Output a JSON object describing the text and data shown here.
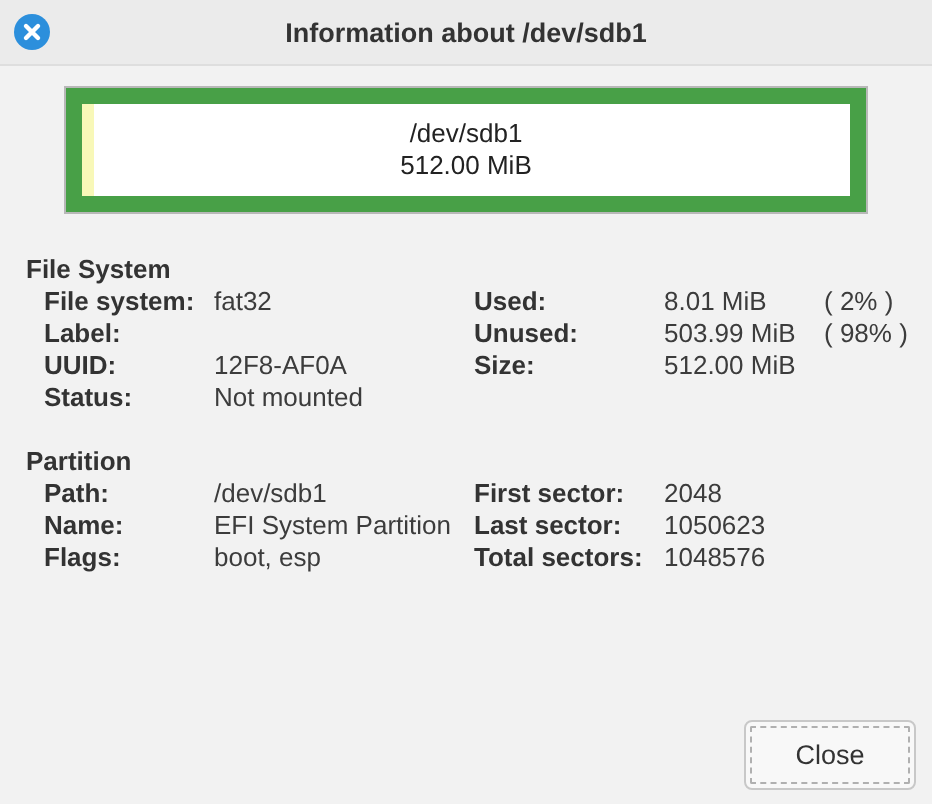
{
  "window": {
    "title": "Information about /dev/sdb1"
  },
  "usage_bar": {
    "name": "/dev/sdb1",
    "size": "512.00 MiB",
    "level": 0.016
  },
  "sections": [
    {
      "title": "File System",
      "left": [
        {
          "label": "File system:",
          "value": "fat32"
        },
        {
          "label": "Label:"
        },
        {
          "label": "UUID:",
          "value": "12F8-AF0A"
        },
        {
          "label": "Status:",
          "value": "Not mounted"
        }
      ],
      "right": [
        {
          "label": "Used:",
          "value": "8.01 MiB",
          "percent": "( 2% )"
        },
        {
          "label": "Unused:",
          "value": "503.99 MiB",
          "percent": "( 98% )"
        },
        {
          "label": "Size:",
          "value": "512.00 MiB"
        }
      ]
    },
    {
      "title": "Partition",
      "left": [
        {
          "label": "Path:",
          "value": "/dev/sdb1"
        },
        {
          "label": "Name:",
          "value": "EFI System Partition"
        },
        {
          "label": "Flags:",
          "value": "boot, esp"
        }
      ],
      "right": [
        {
          "label": "First sector:",
          "value": "2048"
        },
        {
          "label": "Last sector:",
          "value": "1050623"
        },
        {
          "label": "Total sectors:",
          "value": "1048576"
        }
      ]
    }
  ],
  "buttons": [
    {
      "label": "Close",
      "focused": true
    }
  ]
}
